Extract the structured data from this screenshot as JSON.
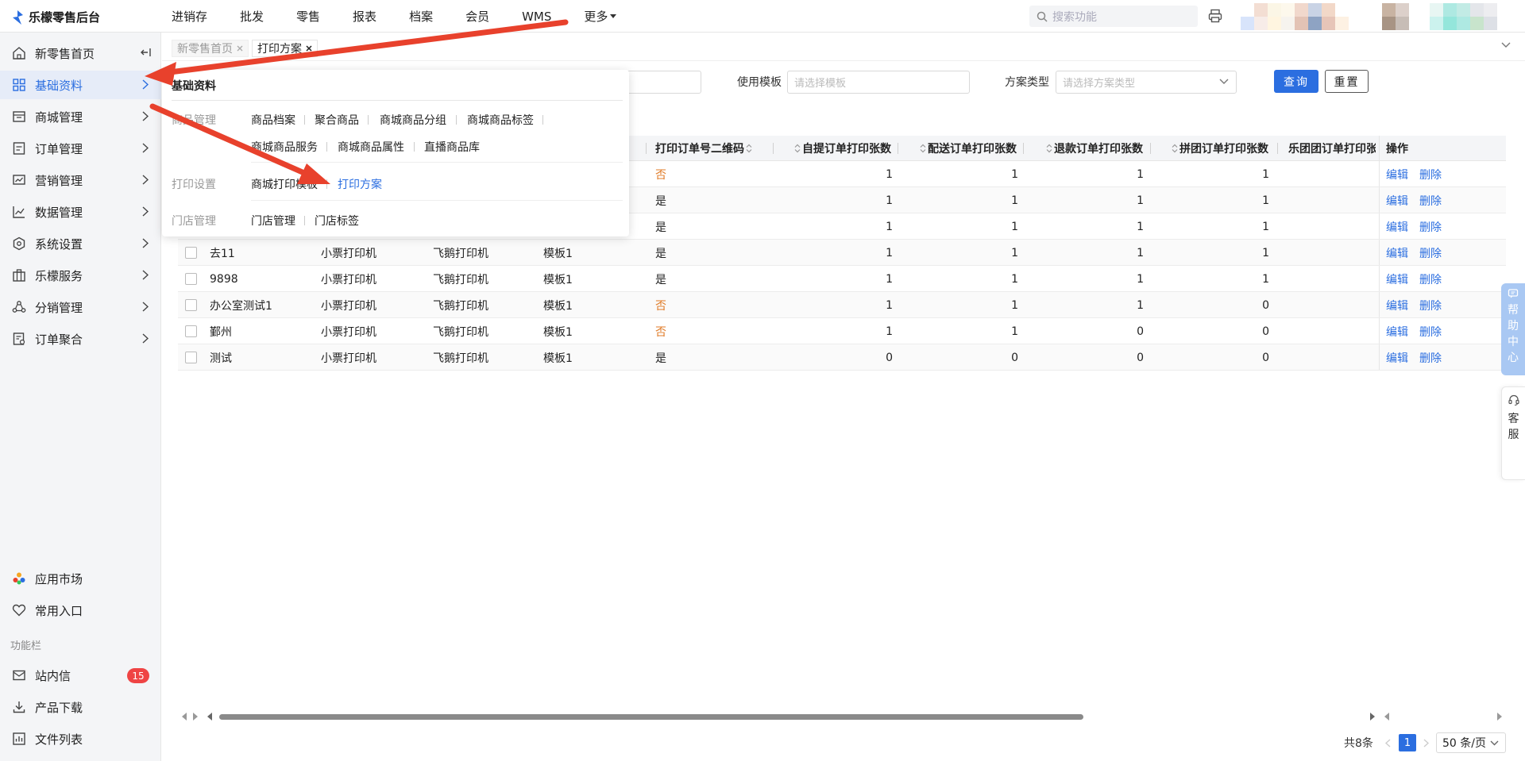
{
  "app": {
    "title": "乐檬零售后台"
  },
  "topnav": [
    "进销存",
    "批发",
    "零售",
    "报表",
    "档案",
    "会员",
    "WMS"
  ],
  "topnav_more": "更多",
  "search": {
    "placeholder": "搜索功能"
  },
  "sidebar": {
    "home": "新零售首页",
    "items": [
      "基础资料",
      "商城管理",
      "订单管理",
      "营销管理",
      "数据管理",
      "系统设置",
      "乐檬服务",
      "分销管理",
      "订单聚合"
    ],
    "bottom_items": [
      "应用市场",
      "常用入口"
    ],
    "section_label": "功能栏",
    "tools": [
      "站内信",
      "产品下载",
      "文件列表"
    ],
    "unread_count": "15"
  },
  "tabs": [
    {
      "label": "新零售首页"
    },
    {
      "label": "打印方案"
    }
  ],
  "filters": {
    "template_label": "使用模板",
    "template_placeholder": "请选择模板",
    "type_label": "方案类型",
    "type_placeholder": "请选择方案类型",
    "query_button": "查询",
    "reset_button": "重置"
  },
  "table": {
    "columns": [
      "打印订单号二维码",
      "自提订单打印张数",
      "配送订单打印张数",
      "退款订单打印张数",
      "拼团订单打印张数",
      "乐团团订单打印张",
      "操作"
    ],
    "edit_label": "编辑",
    "delete_label": "删除",
    "rows": [
      {
        "name": "",
        "printer_type": "",
        "printer_brand": "",
        "template": "",
        "qr": "否",
        "pickup": "1",
        "delivery": "1",
        "refund": "1",
        "group": "1"
      },
      {
        "name": "",
        "printer_type": "",
        "printer_brand": "",
        "template": "",
        "qr": "是",
        "pickup": "1",
        "delivery": "1",
        "refund": "1",
        "group": "1"
      },
      {
        "name": "",
        "printer_type": "",
        "printer_brand": "",
        "template": "",
        "qr": "是",
        "pickup": "1",
        "delivery": "1",
        "refund": "1",
        "group": "1"
      },
      {
        "name": "去11",
        "printer_type": "小票打印机",
        "printer_brand": "飞鹅打印机",
        "template": "模板1",
        "qr": "是",
        "pickup": "1",
        "delivery": "1",
        "refund": "1",
        "group": "1"
      },
      {
        "name": "9898",
        "printer_type": "小票打印机",
        "printer_brand": "飞鹅打印机",
        "template": "模板1",
        "qr": "是",
        "pickup": "1",
        "delivery": "1",
        "refund": "1",
        "group": "1"
      },
      {
        "name": "办公室测试1",
        "printer_type": "小票打印机",
        "printer_brand": "飞鹅打印机",
        "template": "模板1",
        "qr": "否",
        "pickup": "1",
        "delivery": "1",
        "refund": "1",
        "group": "0"
      },
      {
        "name": "鄞州",
        "printer_type": "小票打印机",
        "printer_brand": "飞鹅打印机",
        "template": "模板1",
        "qr": "否",
        "pickup": "1",
        "delivery": "1",
        "refund": "0",
        "group": "0"
      },
      {
        "name": "测试",
        "printer_type": "小票打印机",
        "printer_brand": "飞鹅打印机",
        "template": "模板1",
        "qr": "是",
        "pickup": "0",
        "delivery": "0",
        "refund": "0",
        "group": "0"
      }
    ]
  },
  "pagination": {
    "total": "共8条",
    "current": "1",
    "page_size": "50 条/页"
  },
  "float": {
    "help": [
      "帮",
      "助",
      "中",
      "心"
    ],
    "service": [
      "客",
      "服"
    ]
  },
  "dropdown": {
    "title": "基础资料",
    "groups": [
      {
        "label": "商品管理",
        "links": [
          "商品档案",
          "聚合商品",
          "商城商品分组",
          "商城商品标签",
          "商城商品服务",
          "商城商品属性",
          "直播商品库"
        ]
      },
      {
        "label": "打印设置",
        "links": [
          "商城打印模板",
          "打印方案"
        ]
      },
      {
        "label": "门店管理",
        "links": [
          "门店管理",
          "门店标签"
        ]
      }
    ]
  },
  "colors": {
    "accent": "#2b6ee0",
    "warn": "#e07b27",
    "badge": "#ef4444",
    "arrow": "#e8412c"
  }
}
